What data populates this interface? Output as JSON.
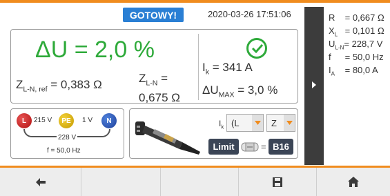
{
  "status": {
    "label": "GOTOWY!"
  },
  "datetime": "2020-03-26 17:51:06",
  "main": {
    "result": "ΔU = 2,0 %",
    "zref": {
      "prefix": "Z",
      "sub": "L-N, ref",
      "value": " = 0,383 Ω"
    },
    "zln": {
      "prefix": "Z",
      "sub": "L-N",
      "eq": " =",
      "value": "0,675 Ω"
    },
    "ik": {
      "prefix": "I",
      "sub": "k",
      "value": " = 341 A"
    },
    "umax": {
      "prefix": "ΔU",
      "sub": "MAX",
      "value": " = 3,0 %"
    },
    "status_icon": "check-circle-icon"
  },
  "wiring": {
    "l": "L",
    "pe": "PE",
    "n": "N",
    "v_l_pe": "215 V",
    "v_pe_n": "1 V",
    "v_l_n": "228 V",
    "freq": "f = 50,0 Hz"
  },
  "probe": {
    "ik_prefix": "I",
    "ik_sub": "k",
    "ik_select": "(L",
    "z_select": "Z",
    "limit": "Limit",
    "eq": "=",
    "fuse": "B16"
  },
  "side_results": [
    {
      "label": "R",
      "sub": "",
      "value": " = 0,667 Ω"
    },
    {
      "label": "X",
      "sub": "L",
      "value": " = 0,101 Ω"
    },
    {
      "label": "U",
      "sub": "L-N",
      "value": "= 228,7 V"
    },
    {
      "label": "f",
      "sub": "",
      "value": " = 50,0 Hz"
    },
    {
      "label": "I",
      "sub": "A",
      "value": " = 80,0 A"
    }
  ],
  "colors": {
    "accent": "#f08c1e",
    "ok_green": "#2eaa3a",
    "badge_blue": "#2a7fd4",
    "dark": "#3b4556"
  },
  "nav": [
    "back-arrow-icon",
    "save-icon",
    "home-icon"
  ]
}
